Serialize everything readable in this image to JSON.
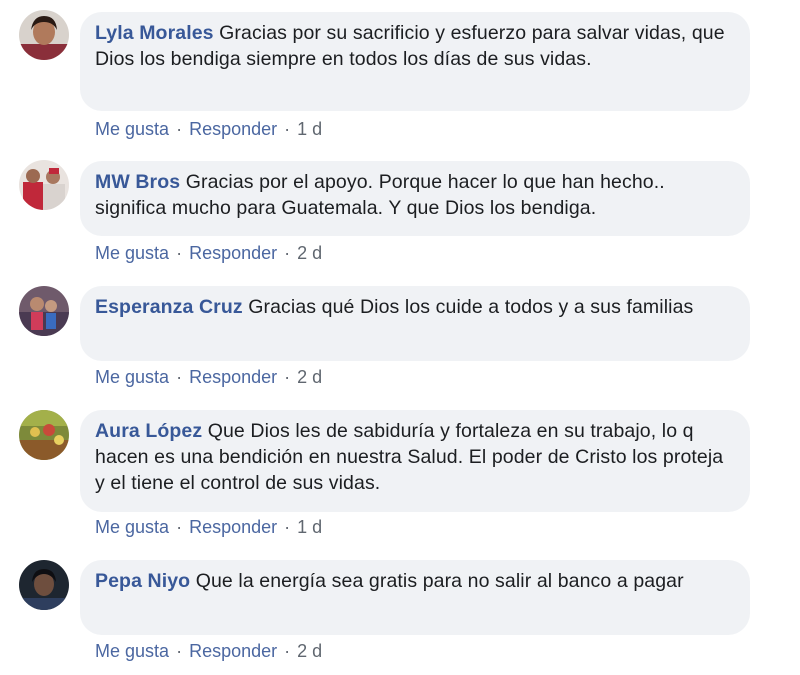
{
  "comments": [
    {
      "author": "Lyla Morales",
      "text": "Gracias por su sacrificio y esfuerzo para salvar vidas, que Dios los bendiga siempre en todos los días de sus vidas.",
      "like_label": "Me gusta",
      "reply_label": "Responder",
      "time": "1 d"
    },
    {
      "author": "MW Bros",
      "text": "Gracias por el apoyo. Porque hacer lo que han hecho.. significa mucho para Guatemala. Y que Dios los bendiga.",
      "like_label": "Me gusta",
      "reply_label": "Responder",
      "time": "2 d"
    },
    {
      "author": "Esperanza Cruz",
      "text": "Gracias qué Dios los cuide a todos y a sus familias",
      "like_label": "Me gusta",
      "reply_label": "Responder",
      "time": "2 d"
    },
    {
      "author": "Aura López",
      "text": "Que Dios les de sabiduría y fortaleza en su trabajo, lo q hacen es una bendición en nuestra Salud. El poder de Cristo los proteja y el tiene el control de sus vidas.",
      "like_label": "Me gusta",
      "reply_label": "Responder",
      "time": "1 d"
    },
    {
      "author": "Pepa Niyo",
      "text": "Que la energía sea gratis para no salir al banco a pagar",
      "like_label": "Me gusta",
      "reply_label": "Responder",
      "time": "2 d"
    }
  ],
  "separator": "·",
  "colors": {
    "bubble": "#f0f2f5",
    "author": "#385898",
    "text": "#1c1e21",
    "action_link": "#4b67a1",
    "action_meta": "#606770"
  }
}
